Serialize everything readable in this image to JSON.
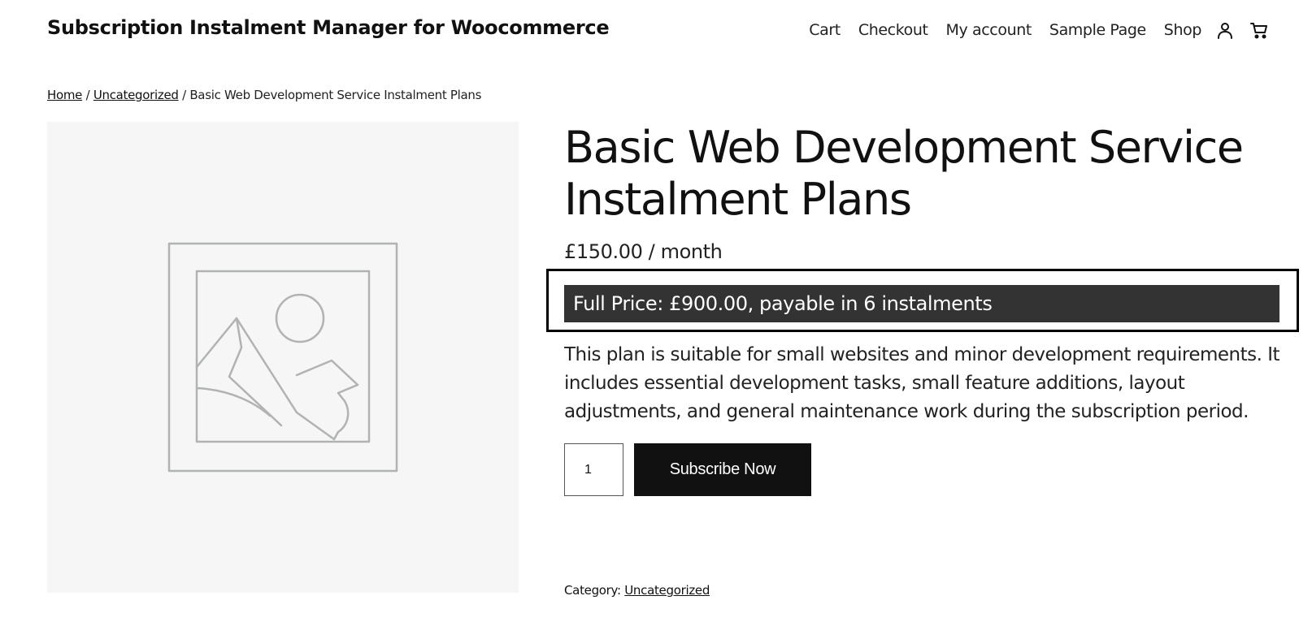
{
  "header": {
    "site_title": "Subscription Instalment Manager for Woocommerce",
    "nav": [
      {
        "label": "Cart"
      },
      {
        "label": "Checkout"
      },
      {
        "label": "My account"
      },
      {
        "label": "Sample Page"
      },
      {
        "label": "Shop"
      }
    ],
    "icons": [
      "user-icon",
      "cart-icon"
    ]
  },
  "breadcrumb": {
    "home": "Home",
    "sep1": " / ",
    "category": "Uncategorized",
    "sep2": " / ",
    "current": "Basic Web Development Service Instalment Plans"
  },
  "product": {
    "image_icon": "image-placeholder-icon",
    "title": "Basic Web Development Service Instalment Plans",
    "price": "£150.00 / month",
    "full_price_text": "Full Price: £900.00, payable in 6 instalments",
    "description": "This plan is suitable for small websites and minor development requirements. It includes essential development tasks, small feature additions, layout adjustments, and general maintenance work during the subscription period.",
    "quantity": "1",
    "subscribe_label": "Subscribe Now",
    "category_label": "Category:",
    "category_value": "Uncategorized"
  },
  "colors": {
    "accent_dark": "#111111",
    "full_price_bg": "#333333",
    "image_bg": "#f5f6f5"
  }
}
